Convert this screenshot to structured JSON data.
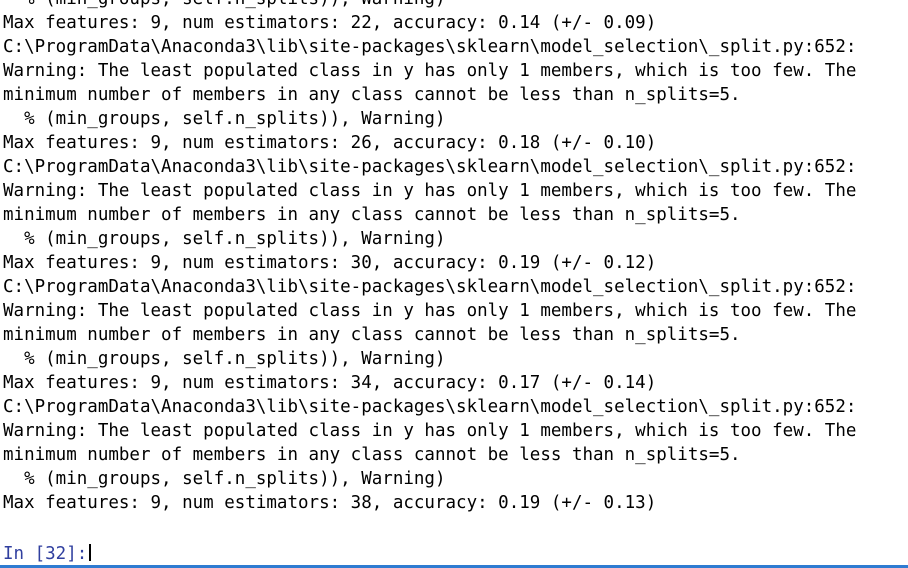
{
  "output_lines": [
    "  % (min_groups, self.n_splits)), Warning)",
    "Max features: 9, num estimators: 22, accuracy: 0.14 (+/- 0.09)",
    "C:\\ProgramData\\Anaconda3\\lib\\site-packages\\sklearn\\model_selection\\_split.py:652:",
    "Warning: The least populated class in y has only 1 members, which is too few. The",
    "minimum number of members in any class cannot be less than n_splits=5.",
    "  % (min_groups, self.n_splits)), Warning)",
    "Max features: 9, num estimators: 26, accuracy: 0.18 (+/- 0.10)",
    "C:\\ProgramData\\Anaconda3\\lib\\site-packages\\sklearn\\model_selection\\_split.py:652:",
    "Warning: The least populated class in y has only 1 members, which is too few. The",
    "minimum number of members in any class cannot be less than n_splits=5.",
    "  % (min_groups, self.n_splits)), Warning)",
    "Max features: 9, num estimators: 30, accuracy: 0.19 (+/- 0.12)",
    "C:\\ProgramData\\Anaconda3\\lib\\site-packages\\sklearn\\model_selection\\_split.py:652:",
    "Warning: The least populated class in y has only 1 members, which is too few. The",
    "minimum number of members in any class cannot be less than n_splits=5.",
    "  % (min_groups, self.n_splits)), Warning)",
    "Max features: 9, num estimators: 34, accuracy: 0.17 (+/- 0.14)",
    "C:\\ProgramData\\Anaconda3\\lib\\site-packages\\sklearn\\model_selection\\_split.py:652:",
    "Warning: The least populated class in y has only 1 members, which is too few. The",
    "minimum number of members in any class cannot be less than n_splits=5.",
    "  % (min_groups, self.n_splits)), Warning)",
    "Max features: 9, num estimators: 38, accuracy: 0.19 (+/- 0.13)"
  ],
  "prompt": {
    "label": "In [32]:"
  },
  "colors": {
    "prompt": "#303F9F",
    "text": "#000000",
    "background": "#ffffff",
    "bottom_rule": "#2f7bd1"
  }
}
